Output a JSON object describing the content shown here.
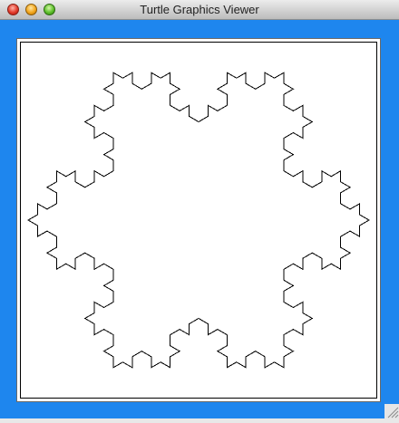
{
  "window": {
    "title": "Turtle Graphics Viewer",
    "background_color": "#1e86ee",
    "canvas_background": "#ffffff",
    "stroke_color": "#000000"
  },
  "drawing": {
    "shape": "koch-snowflake",
    "recursion_level": 3
  }
}
